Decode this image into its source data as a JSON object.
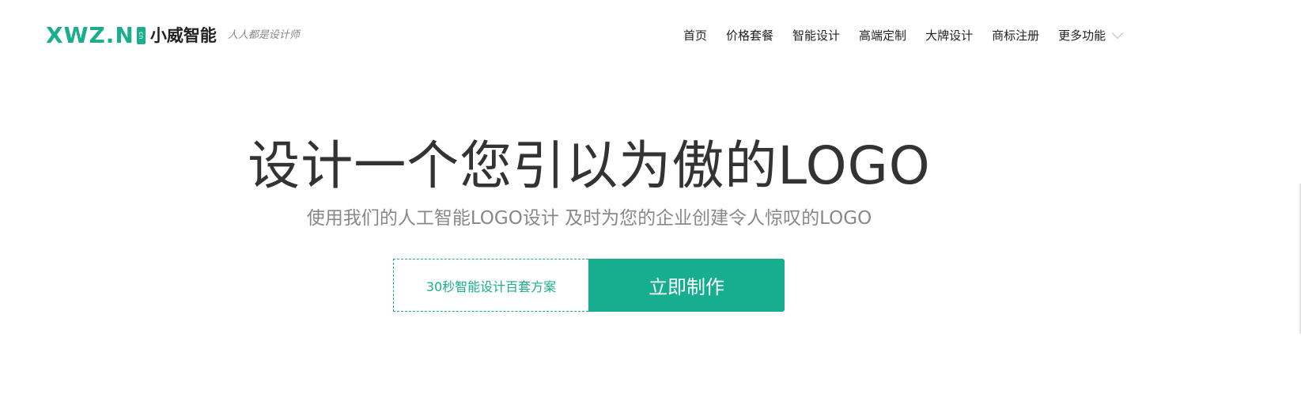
{
  "brand": {
    "mark": "XWZ.N",
    "cn_tag": "cn",
    "name": "小威智能",
    "slogan": "人人都是设计师",
    "accent_color": "#1aae8c"
  },
  "nav": {
    "items": [
      {
        "label": "首页"
      },
      {
        "label": "价格套餐"
      },
      {
        "label": "智能设计"
      },
      {
        "label": "高端定制"
      },
      {
        "label": "大牌设计"
      },
      {
        "label": "商标注册"
      }
    ],
    "more_label": "更多功能",
    "more_icon": "chevron-down-icon"
  },
  "hero": {
    "title": "设计一个您引以为傲的LOGO",
    "subtitle": "使用我们的人工智能LOGO设计 及时为您的企业创建令人惊叹的LOGO",
    "cta_note": "30秒智能设计百套方案",
    "cta_button": "立即制作",
    "button_color": "#17ae8f"
  }
}
